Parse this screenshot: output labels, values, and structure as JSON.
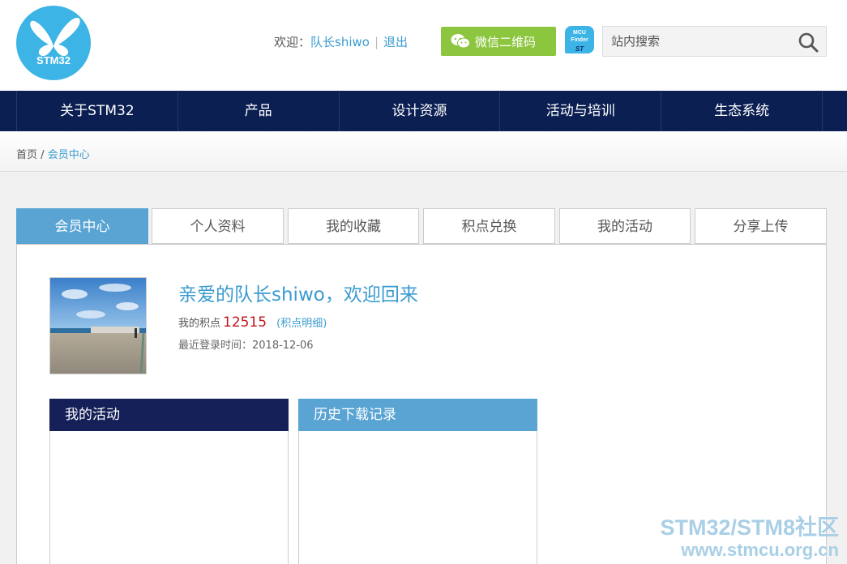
{
  "header": {
    "logo_text": "STM32",
    "welcome_label": "欢迎：",
    "username": "队长shiwo",
    "separator": "|",
    "logout": "退出",
    "wechat_button": "微信二维码",
    "mcu_finder_line1": "MCU",
    "mcu_finder_line2": "Finder",
    "mcu_finder_brand": "ST",
    "search_placeholder": "站内搜索"
  },
  "nav": {
    "items": [
      "关于STM32",
      "产品",
      "设计资源",
      "活动与培训",
      "生态系统"
    ]
  },
  "breadcrumb": {
    "home": "首页",
    "separator": "/",
    "current": "会员中心"
  },
  "tabs": [
    "会员中心",
    "个人资料",
    "我的收藏",
    "积点兑换",
    "我的活动",
    "分享上传"
  ],
  "profile": {
    "greeting": "亲爱的队长shiwo，欢迎回来",
    "points_label": "我的积点",
    "points_value": "12515",
    "points_link_open": "(",
    "points_link": "积点明细",
    "points_link_close": ")",
    "last_login": "最近登录时间：2018-12-06"
  },
  "boxes": {
    "activity_title": "我的活动",
    "download_title": "历史下载记录"
  },
  "watermark": {
    "line1": "STM32/STM8社区",
    "line2": "www.stmcu.org.cn"
  },
  "colors": {
    "nav_bg": "#0b1f52",
    "accent_blue": "#3a9bd0",
    "tab_active": "#5aa4d4",
    "wechat_green": "#8cc63f",
    "points_red": "#c0161e"
  }
}
